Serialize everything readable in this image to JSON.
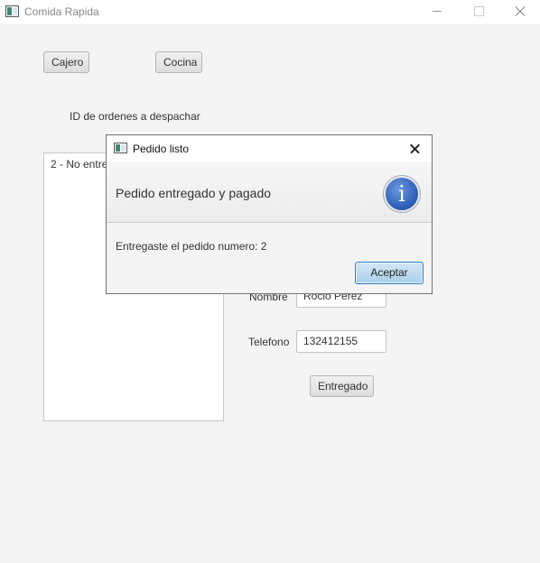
{
  "window": {
    "title": "Comida Rapida"
  },
  "toolbar": {
    "cajero_label": "Cajero",
    "cocina_label": "Cocina"
  },
  "orders": {
    "heading": "ID de ordenes a despachar",
    "items": [
      "2 - No entregado"
    ]
  },
  "form": {
    "nombre_label": "Nombre",
    "nombre_value": "Rocio Perez",
    "telefono_label": "Telefono",
    "telefono_value": "132412155",
    "entregado_label": "Entregado"
  },
  "dialog": {
    "title": "Pedido listo",
    "header": "Pedido entregado y pagado",
    "icon": "info-icon",
    "icon_glyph": "i",
    "content": "Entregaste el pedido numero: 2",
    "accept_label": "Aceptar"
  },
  "colors": {
    "accent": "#2f7ec4",
    "info_icon": "#2a5bb4"
  }
}
